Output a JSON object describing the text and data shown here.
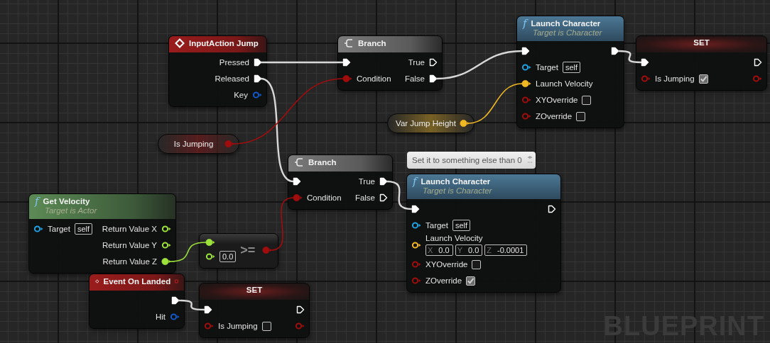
{
  "graph": {
    "nodes": [
      {
        "kind": "event",
        "title": "InputAction Jump",
        "outputs": [
          {
            "kind": "exec",
            "label": "Pressed",
            "connected": true
          },
          {
            "kind": "exec",
            "label": "Released",
            "connected": true
          },
          {
            "kind": "struct",
            "label": "Key",
            "connected": false
          }
        ]
      },
      {
        "kind": "variable",
        "title": "Is Jumping",
        "outputs": [
          {
            "kind": "bool",
            "connected": true
          }
        ]
      },
      {
        "kind": "branch",
        "title": "Branch",
        "inputs": [
          {
            "kind": "exec",
            "connected": true
          },
          {
            "kind": "bool",
            "label": "Condition",
            "connected": true
          }
        ],
        "outputs": [
          {
            "kind": "exec",
            "label": "True",
            "connected": false
          },
          {
            "kind": "exec",
            "label": "False",
            "connected": true
          }
        ]
      },
      {
        "kind": "variable",
        "title": "Var Jump Height",
        "outputs": [
          {
            "kind": "vector",
            "connected": true
          }
        ]
      },
      {
        "kind": "function",
        "pure": false,
        "icon": "f",
        "title": "Launch Character",
        "subtitle": "Target is Character",
        "inputs": [
          {
            "kind": "exec",
            "connected": true
          },
          {
            "kind": "object",
            "label": "Target",
            "value": "self",
            "connected": false
          },
          {
            "kind": "vector",
            "label": "Launch Velocity",
            "connected": true
          },
          {
            "kind": "bool",
            "label": "XYOverride",
            "checked": false,
            "connected": false
          },
          {
            "kind": "bool",
            "label": "ZOverride",
            "checked": false,
            "connected": false
          }
        ],
        "outputs": [
          {
            "kind": "exec",
            "connected": true
          }
        ]
      },
      {
        "kind": "set",
        "title": "SET",
        "inputs": [
          {
            "kind": "exec",
            "connected": true
          },
          {
            "kind": "bool",
            "label": "Is Jumping",
            "checked": true,
            "connected": false
          }
        ],
        "outputs": [
          {
            "kind": "exec",
            "connected": false
          },
          {
            "kind": "bool",
            "connected": false
          }
        ]
      },
      {
        "kind": "function",
        "pure": true,
        "icon": "f",
        "title": "Get Velocity",
        "subtitle": "Target is Actor",
        "inputs": [
          {
            "kind": "object",
            "label": "Target",
            "value": "self",
            "connected": false
          }
        ],
        "outputs": [
          {
            "kind": "float",
            "label": "Return Value X",
            "connected": false
          },
          {
            "kind": "float",
            "label": "Return Value Y",
            "connected": false
          },
          {
            "kind": "float",
            "label": "Return Value Z",
            "connected": true
          }
        ]
      },
      {
        "kind": "event",
        "title": "Event On Landed",
        "delegate": true,
        "outputs": [
          {
            "kind": "exec",
            "connected": true
          },
          {
            "kind": "struct",
            "label": "Hit",
            "connected": false
          }
        ]
      },
      {
        "kind": "operator",
        "title": ">=",
        "inputs": [
          {
            "kind": "float",
            "connected": true
          },
          {
            "kind": "float",
            "value": "0.0",
            "connected": false
          }
        ],
        "outputs": [
          {
            "kind": "bool",
            "connected": true
          }
        ]
      },
      {
        "kind": "set",
        "title": "SET",
        "inputs": [
          {
            "kind": "exec",
            "connected": true
          },
          {
            "kind": "bool",
            "label": "Is Jumping",
            "checked": false,
            "connected": false
          }
        ],
        "outputs": [
          {
            "kind": "exec",
            "connected": false
          },
          {
            "kind": "bool",
            "connected": false
          }
        ]
      },
      {
        "kind": "branch",
        "title": "Branch",
        "inputs": [
          {
            "kind": "exec",
            "connected": true
          },
          {
            "kind": "bool",
            "label": "Condition",
            "connected": true
          }
        ],
        "outputs": [
          {
            "kind": "exec",
            "label": "True",
            "connected": true
          },
          {
            "kind": "exec",
            "label": "False",
            "connected": false
          }
        ]
      },
      {
        "kind": "comment",
        "title": "Set it to something else than 0"
      },
      {
        "kind": "function",
        "pure": false,
        "icon": "f",
        "title": "Launch Character",
        "subtitle": "Target is Character",
        "inputs": [
          {
            "kind": "exec",
            "connected": true
          },
          {
            "kind": "object",
            "label": "Target",
            "value": "self",
            "connected": false
          },
          {
            "kind": "vector",
            "label": "Launch Velocity",
            "components": [
              {
                "axis": "X",
                "value": "0.0"
              },
              {
                "axis": "Y",
                "value": "0.0"
              },
              {
                "axis": "Z",
                "value": "-0.0001"
              }
            ],
            "connected": false
          },
          {
            "kind": "bool",
            "label": "XYOverride",
            "checked": false,
            "connected": false
          },
          {
            "kind": "bool",
            "label": "ZOverride",
            "checked": true,
            "connected": false
          }
        ],
        "outputs": [
          {
            "kind": "exec",
            "connected": false
          }
        ]
      }
    ],
    "graph_label": "BLUEPRINT"
  }
}
